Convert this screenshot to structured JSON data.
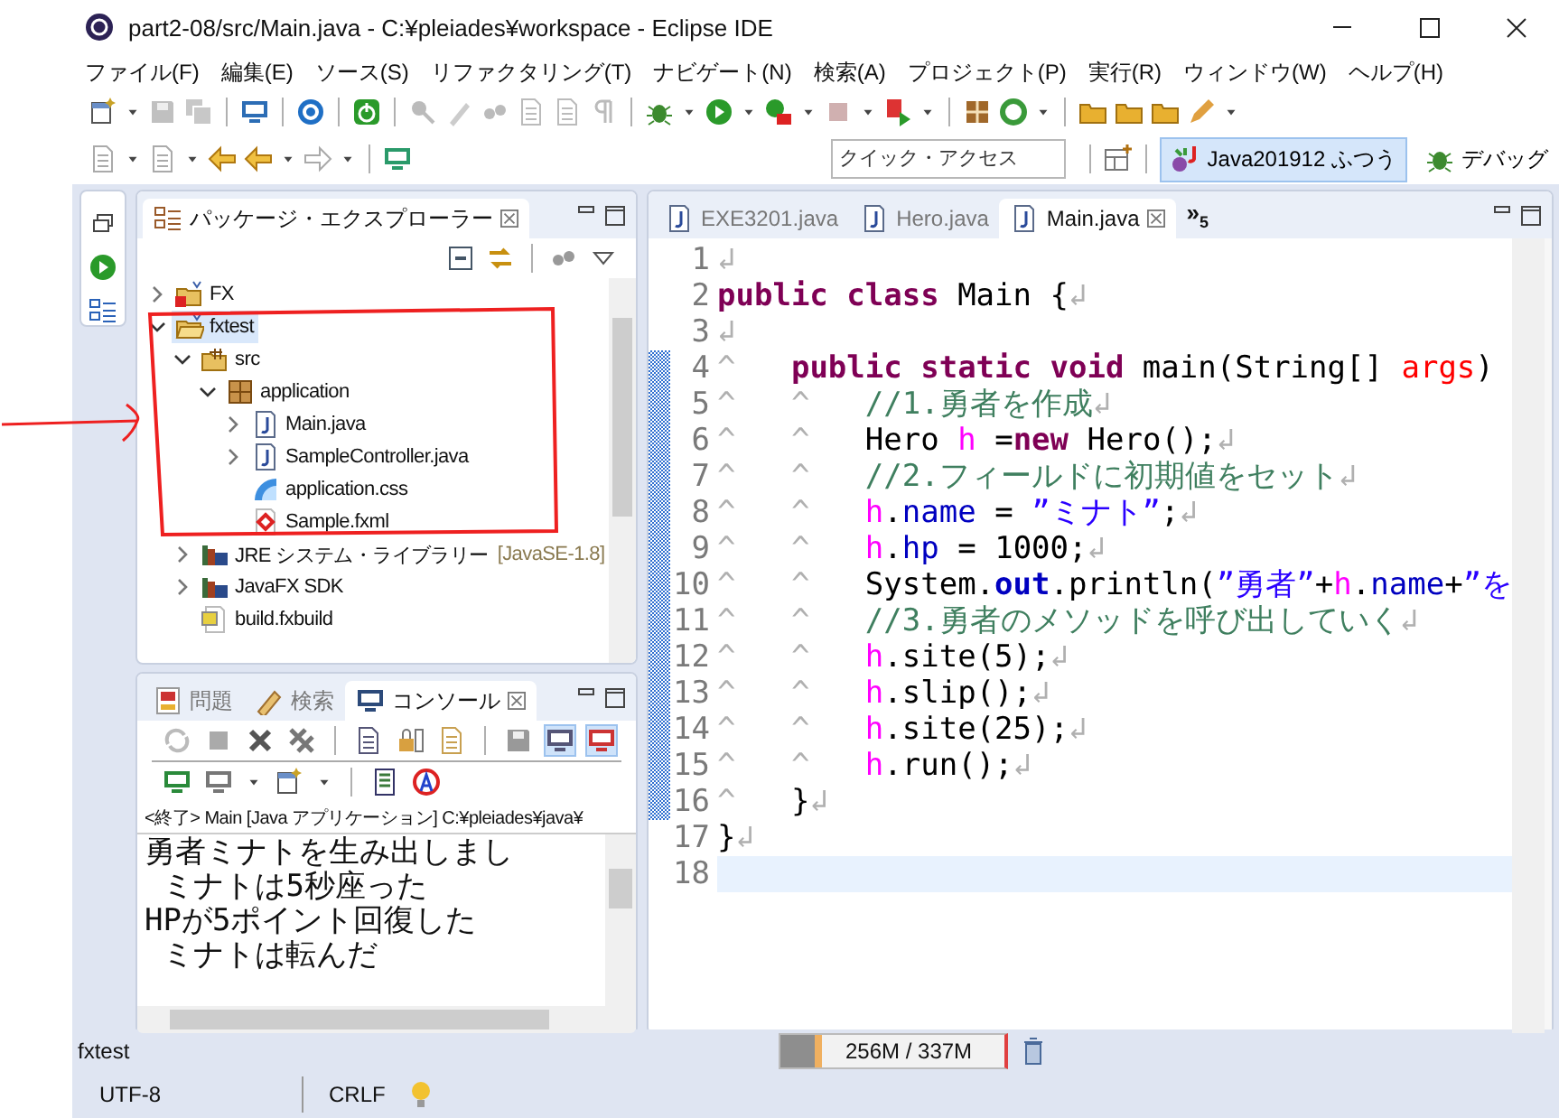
{
  "window": {
    "title": "part2-08/src/Main.java - C:¥pleiades¥workspace - Eclipse IDE"
  },
  "menu": [
    "ファイル(F)",
    "編集(E)",
    "ソース(S)",
    "リファクタリング(T)",
    "ナビゲート(N)",
    "検索(A)",
    "プロジェクト(P)",
    "実行(R)",
    "ウィンドウ(W)",
    "ヘルプ(H)"
  ],
  "quick_access": {
    "placeholder": "クイック・アクセス"
  },
  "perspectives": [
    {
      "label": "Java201912 ふつう",
      "kind": "java",
      "selected": true
    },
    {
      "label": "デバッグ",
      "kind": "debug",
      "selected": false
    }
  ],
  "package_explorer": {
    "tab": "パッケージ・エクスプローラー",
    "tree": [
      {
        "label": "FX",
        "kind": "project-error",
        "expanded": false,
        "selected": false
      },
      {
        "label": "fxtest",
        "kind": "project",
        "expanded": true,
        "selected": true,
        "children": [
          {
            "label": "src",
            "kind": "source-folder",
            "expanded": true,
            "selected": false,
            "children": [
              {
                "label": "application",
                "kind": "package",
                "expanded": true,
                "selected": false,
                "children": [
                  {
                    "label": "Main.java",
                    "kind": "java",
                    "expanded": false,
                    "selected": false
                  },
                  {
                    "label": "SampleController.java",
                    "kind": "java",
                    "expanded": false,
                    "selected": false
                  },
                  {
                    "label": "application.css",
                    "kind": "css",
                    "selected": false
                  },
                  {
                    "label": "Sample.fxml",
                    "kind": "fxml",
                    "selected": false
                  }
                ]
              }
            ]
          },
          {
            "label": "JRE システム・ライブラリー",
            "decoration": "[JavaSE-1.8]",
            "kind": "library",
            "expanded": false,
            "selected": false
          },
          {
            "label": "JavaFX SDK",
            "kind": "library",
            "expanded": false,
            "selected": false
          },
          {
            "label": "build.fxbuild",
            "kind": "file",
            "selected": false
          }
        ]
      }
    ]
  },
  "console": {
    "tabs": [
      {
        "label": "問題",
        "kind": "problems",
        "selected": false
      },
      {
        "label": "検索",
        "kind": "search",
        "selected": false
      },
      {
        "label": "コンソール",
        "kind": "console",
        "selected": true
      }
    ],
    "header": "<終了> Main [Java アプリケーション] C:¥pleiades¥java¥",
    "output": [
      "勇者ミナトを生み出しまし",
      " ミナトは5秒座った",
      "HPが5ポイント回復した",
      " ミナトは転んだ"
    ]
  },
  "editor": {
    "tabs": [
      {
        "label": "EXE3201.java",
        "selected": false
      },
      {
        "label": "Hero.java",
        "selected": false
      },
      {
        "label": "Main.java",
        "selected": true
      }
    ],
    "overflow": {
      "glyph": "»",
      "count": "5"
    },
    "lines": [
      {
        "number": "1",
        "changed": false,
        "current": false,
        "segments": [
          {
            "kind": "mark",
            "text": "↲"
          }
        ]
      },
      {
        "number": "2",
        "changed": false,
        "current": false,
        "segments": [
          {
            "kind": "keyword",
            "text": "public class"
          },
          {
            "kind": "plain",
            "text": " Main {"
          },
          {
            "kind": "mark",
            "text": "↲"
          }
        ]
      },
      {
        "number": "3",
        "changed": false,
        "current": false,
        "segments": [
          {
            "kind": "mark",
            "text": "↲"
          }
        ]
      },
      {
        "number": "4",
        "changed": true,
        "current": false,
        "segments": [
          {
            "kind": "mark",
            "text": "^   "
          },
          {
            "kind": "keyword",
            "text": "public static void"
          },
          {
            "kind": "plain",
            "text": " main(String[] "
          },
          {
            "kind": "param",
            "text": "args"
          },
          {
            "kind": "plain",
            "text": ")"
          }
        ]
      },
      {
        "number": "5",
        "changed": true,
        "current": false,
        "segments": [
          {
            "kind": "mark",
            "text": "^   ^   "
          },
          {
            "kind": "comment",
            "text": "//1.勇者を作成"
          },
          {
            "kind": "mark",
            "text": "↲"
          }
        ]
      },
      {
        "number": "6",
        "changed": true,
        "current": false,
        "segments": [
          {
            "kind": "mark",
            "text": "^   ^   "
          },
          {
            "kind": "plain",
            "text": "Hero "
          },
          {
            "kind": "local",
            "text": "h"
          },
          {
            "kind": "plain",
            "text": " ="
          },
          {
            "kind": "keyword",
            "text": "new"
          },
          {
            "kind": "plain",
            "text": " Hero();"
          },
          {
            "kind": "mark",
            "text": "↲"
          }
        ]
      },
      {
        "number": "7",
        "changed": true,
        "current": false,
        "segments": [
          {
            "kind": "mark",
            "text": "^   ^   "
          },
          {
            "kind": "comment",
            "text": "//2.フィールドに初期値をセット"
          },
          {
            "kind": "mark",
            "text": "↲"
          }
        ]
      },
      {
        "number": "8",
        "changed": true,
        "current": false,
        "segments": [
          {
            "kind": "mark",
            "text": "^   ^   "
          },
          {
            "kind": "local",
            "text": "h"
          },
          {
            "kind": "plain",
            "text": "."
          },
          {
            "kind": "field",
            "text": "name"
          },
          {
            "kind": "plain",
            "text": " = "
          },
          {
            "kind": "string",
            "text": "”ミナト”"
          },
          {
            "kind": "plain",
            "text": ";"
          },
          {
            "kind": "mark",
            "text": "↲"
          }
        ]
      },
      {
        "number": "9",
        "changed": true,
        "current": false,
        "segments": [
          {
            "kind": "mark",
            "text": "^   ^   "
          },
          {
            "kind": "local",
            "text": "h"
          },
          {
            "kind": "plain",
            "text": "."
          },
          {
            "kind": "field",
            "text": "hp"
          },
          {
            "kind": "plain",
            "text": " = 1000;"
          },
          {
            "kind": "mark",
            "text": "↲"
          }
        ]
      },
      {
        "number": "10",
        "changed": true,
        "current": false,
        "segments": [
          {
            "kind": "mark",
            "text": "^   ^   "
          },
          {
            "kind": "plain",
            "text": "System."
          },
          {
            "kind": "static",
            "text": "out"
          },
          {
            "kind": "plain",
            "text": ".println("
          },
          {
            "kind": "string",
            "text": "”勇者”"
          },
          {
            "kind": "plain",
            "text": "+"
          },
          {
            "kind": "local",
            "text": "h"
          },
          {
            "kind": "plain",
            "text": "."
          },
          {
            "kind": "field",
            "text": "name"
          },
          {
            "kind": "plain",
            "text": "+"
          },
          {
            "kind": "string",
            "text": "”を"
          }
        ]
      },
      {
        "number": "11",
        "changed": true,
        "current": false,
        "segments": [
          {
            "kind": "mark",
            "text": "^   ^   "
          },
          {
            "kind": "comment",
            "text": "//3.勇者のメソッドを呼び出していく"
          },
          {
            "kind": "mark",
            "text": "↲"
          }
        ]
      },
      {
        "number": "12",
        "changed": true,
        "current": false,
        "segments": [
          {
            "kind": "mark",
            "text": "^   ^   "
          },
          {
            "kind": "local",
            "text": "h"
          },
          {
            "kind": "plain",
            "text": ".site(5);"
          },
          {
            "kind": "mark",
            "text": "↲"
          }
        ]
      },
      {
        "number": "13",
        "changed": true,
        "current": false,
        "segments": [
          {
            "kind": "mark",
            "text": "^   ^   "
          },
          {
            "kind": "local",
            "text": "h"
          },
          {
            "kind": "plain",
            "text": ".slip();"
          },
          {
            "kind": "mark",
            "text": "↲"
          }
        ]
      },
      {
        "number": "14",
        "changed": true,
        "current": false,
        "segments": [
          {
            "kind": "mark",
            "text": "^   ^   "
          },
          {
            "kind": "local",
            "text": "h"
          },
          {
            "kind": "plain",
            "text": ".site(25);"
          },
          {
            "kind": "mark",
            "text": "↲"
          }
        ]
      },
      {
        "number": "15",
        "changed": true,
        "current": false,
        "segments": [
          {
            "kind": "mark",
            "text": "^   ^   "
          },
          {
            "kind": "local",
            "text": "h"
          },
          {
            "kind": "plain",
            "text": ".run();"
          },
          {
            "kind": "mark",
            "text": "↲"
          }
        ]
      },
      {
        "number": "16",
        "changed": true,
        "current": false,
        "segments": [
          {
            "kind": "mark",
            "text": "^   "
          },
          {
            "kind": "plain",
            "text": "}"
          },
          {
            "kind": "mark",
            "text": "↲"
          }
        ]
      },
      {
        "number": "17",
        "changed": false,
        "current": false,
        "segments": [
          {
            "kind": "plain",
            "text": "}"
          },
          {
            "kind": "mark",
            "text": "↲"
          }
        ]
      },
      {
        "number": "18",
        "changed": false,
        "current": true
      }
    ]
  },
  "status_bar": {
    "selection": "fxtest",
    "memory": {
      "reading": "256M / 337M",
      "level": 0.15
    },
    "encoding": "UTF-8",
    "line_delimiter": "CRLF"
  },
  "annotations": {
    "highlight_box": true,
    "arrow": true
  }
}
